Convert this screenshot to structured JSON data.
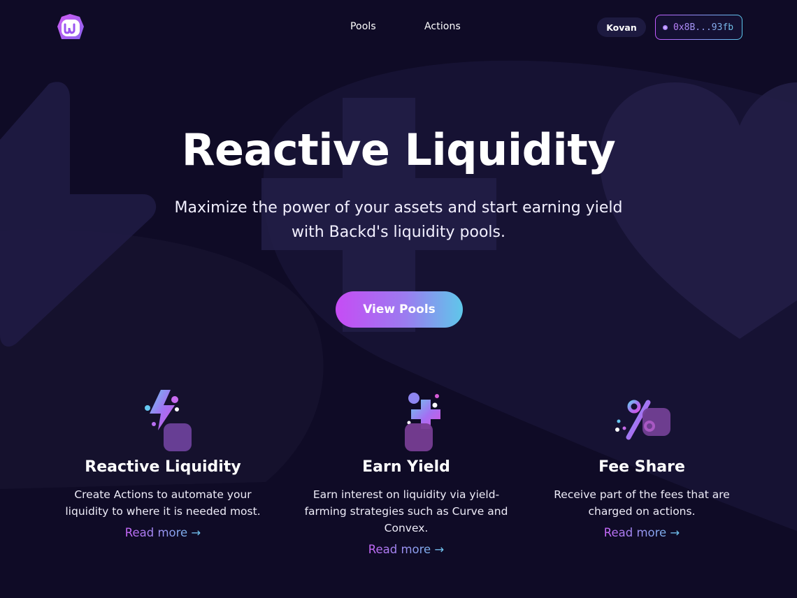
{
  "header": {
    "nav": [
      {
        "label": "Pools"
      },
      {
        "label": "Actions"
      }
    ],
    "network": "Kovan",
    "wallet": "0x8B...93fb"
  },
  "hero": {
    "title": "Reactive Liquidity",
    "subtitle": "Maximize the power of your assets and start earning yield with Backd's liquidity pools.",
    "cta": "View Pools"
  },
  "features": [
    {
      "icon": "lightning-icon",
      "title": "Reactive Liquidity",
      "description": "Create Actions to automate your liquidity to where it is needed most.",
      "link": "Read more →"
    },
    {
      "icon": "plus-icon",
      "title": "Earn Yield",
      "description": "Earn interest on liquidity via yield-farming strategies such as Curve and Convex.",
      "link": "Read more →"
    },
    {
      "icon": "percent-icon",
      "title": "Fee Share",
      "description": "Receive part of the fees that are charged on actions.",
      "link": "Read more →"
    }
  ],
  "colors": {
    "background": "#0f0b26",
    "accent_start": "#c64cf4",
    "accent_end": "#5fc7ea"
  }
}
